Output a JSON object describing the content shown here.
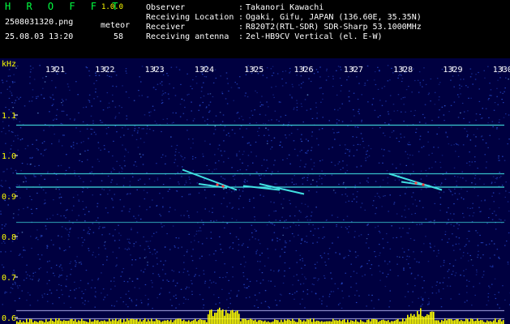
{
  "header": {
    "app_name": "H R O F F T",
    "version": "1.0.0",
    "filename": "2508031320.png",
    "meteor_label": "meteor",
    "datetime": "25.08.03 13:20",
    "meteor_count": "58",
    "info": [
      {
        "label": "Observer",
        "value": "Takanori Kawachi"
      },
      {
        "label": "Receiving Location",
        "value": "Ogaki, Gifu, JAPAN (136.60E, 35.35N)"
      },
      {
        "label": "Receiver",
        "value": "R820T2(RTL-SDR) SDR-Sharp 53.1000MHz"
      },
      {
        "label": "Receiving antenna",
        "value": "2el-HB9CV Vertical (el. E-W)"
      }
    ],
    "separator": ":"
  },
  "spectrogram": {
    "y_unit": "kHz",
    "x_ticks": [
      "1321",
      "1322",
      "1323",
      "1324",
      "1325",
      "1326",
      "1327",
      "1328",
      "1329",
      "1330"
    ],
    "y_ticks": [
      "1.1",
      "1.0",
      "0.9",
      "0.8",
      "0.7",
      "0.6"
    ],
    "colors": {
      "background": "#000040",
      "noise": "#2a4fd8",
      "signal": "#40e0e0",
      "hot": "#ff4040",
      "axis_text": "#ffff00",
      "level_bar": "#ffff00"
    }
  }
}
